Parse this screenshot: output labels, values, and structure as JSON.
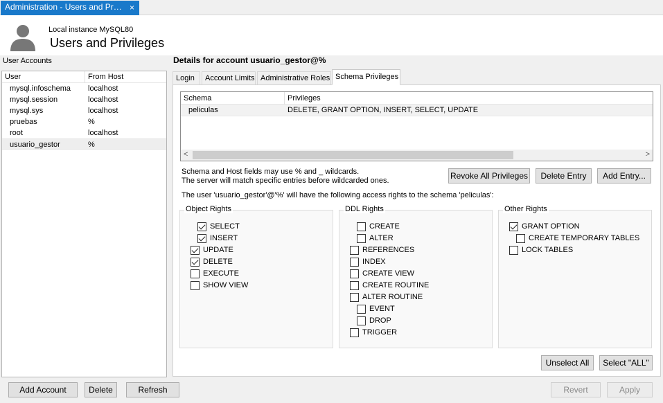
{
  "window": {
    "tab_title": "Administration - Users and Privil...",
    "tab_close": "×"
  },
  "header": {
    "instance": "Local instance MySQL80",
    "title": "Users and Privileges"
  },
  "accounts": {
    "label": "User Accounts",
    "columns": [
      "User",
      "From Host"
    ],
    "rows": [
      {
        "user": "mysql.infoschema",
        "host": "localhost"
      },
      {
        "user": "mysql.session",
        "host": "localhost"
      },
      {
        "user": "mysql.sys",
        "host": "localhost"
      },
      {
        "user": "pruebas",
        "host": "%"
      },
      {
        "user": "root",
        "host": "localhost"
      },
      {
        "user": "usuario_gestor",
        "host": "%"
      }
    ],
    "selected_index": 5
  },
  "bottom_buttons": {
    "add_account": "Add Account",
    "delete": "Delete",
    "refresh": "Refresh",
    "revert": "Revert",
    "apply": "Apply"
  },
  "details": {
    "title": "Details for account usuario_gestor@%",
    "tabs": [
      "Login",
      "Account Limits",
      "Administrative Roles",
      "Schema Privileges"
    ],
    "active_tab": "Schema Privileges"
  },
  "schema_table": {
    "columns": [
      "Schema",
      "Privileges"
    ],
    "rows": [
      {
        "schema": "peliculas",
        "privileges": "DELETE, GRANT OPTION, INSERT, SELECT, UPDATE"
      }
    ],
    "scroll_left": "<",
    "scroll_right": ">"
  },
  "notes": {
    "line1": "Schema and Host fields may use % and _ wildcards.",
    "line2": "The server will match specific entries before wildcarded ones.",
    "access": "The user 'usuario_gestor'@'%' will have the following access rights to the schema 'peliculas':"
  },
  "schema_buttons": {
    "revoke_all": "Revoke All Privileges",
    "delete_entry": "Delete Entry",
    "add_entry": "Add Entry..."
  },
  "groups": {
    "object": {
      "title": "Object Rights",
      "items": [
        {
          "label": "SELECT",
          "checked": true
        },
        {
          "label": "INSERT",
          "checked": true
        },
        {
          "label": "UPDATE",
          "checked": true
        },
        {
          "label": "DELETE",
          "checked": true
        },
        {
          "label": "EXECUTE",
          "checked": false
        },
        {
          "label": "SHOW VIEW",
          "checked": false
        }
      ]
    },
    "ddl": {
      "title": "DDL Rights",
      "items": [
        {
          "label": "CREATE",
          "checked": false
        },
        {
          "label": "ALTER",
          "checked": false
        },
        {
          "label": "REFERENCES",
          "checked": false
        },
        {
          "label": "INDEX",
          "checked": false
        },
        {
          "label": "CREATE VIEW",
          "checked": false
        },
        {
          "label": "CREATE ROUTINE",
          "checked": false
        },
        {
          "label": "ALTER ROUTINE",
          "checked": false
        },
        {
          "label": "EVENT",
          "checked": false
        },
        {
          "label": "DROP",
          "checked": false
        },
        {
          "label": "TRIGGER",
          "checked": false
        }
      ]
    },
    "other": {
      "title": "Other Rights",
      "items": [
        {
          "label": "GRANT OPTION",
          "checked": true
        },
        {
          "label": "CREATE TEMPORARY TABLES",
          "checked": false
        },
        {
          "label": "LOCK TABLES",
          "checked": false
        }
      ]
    }
  },
  "select_buttons": {
    "unselect_all": "Unselect All",
    "select_all": "Select \"ALL\""
  }
}
